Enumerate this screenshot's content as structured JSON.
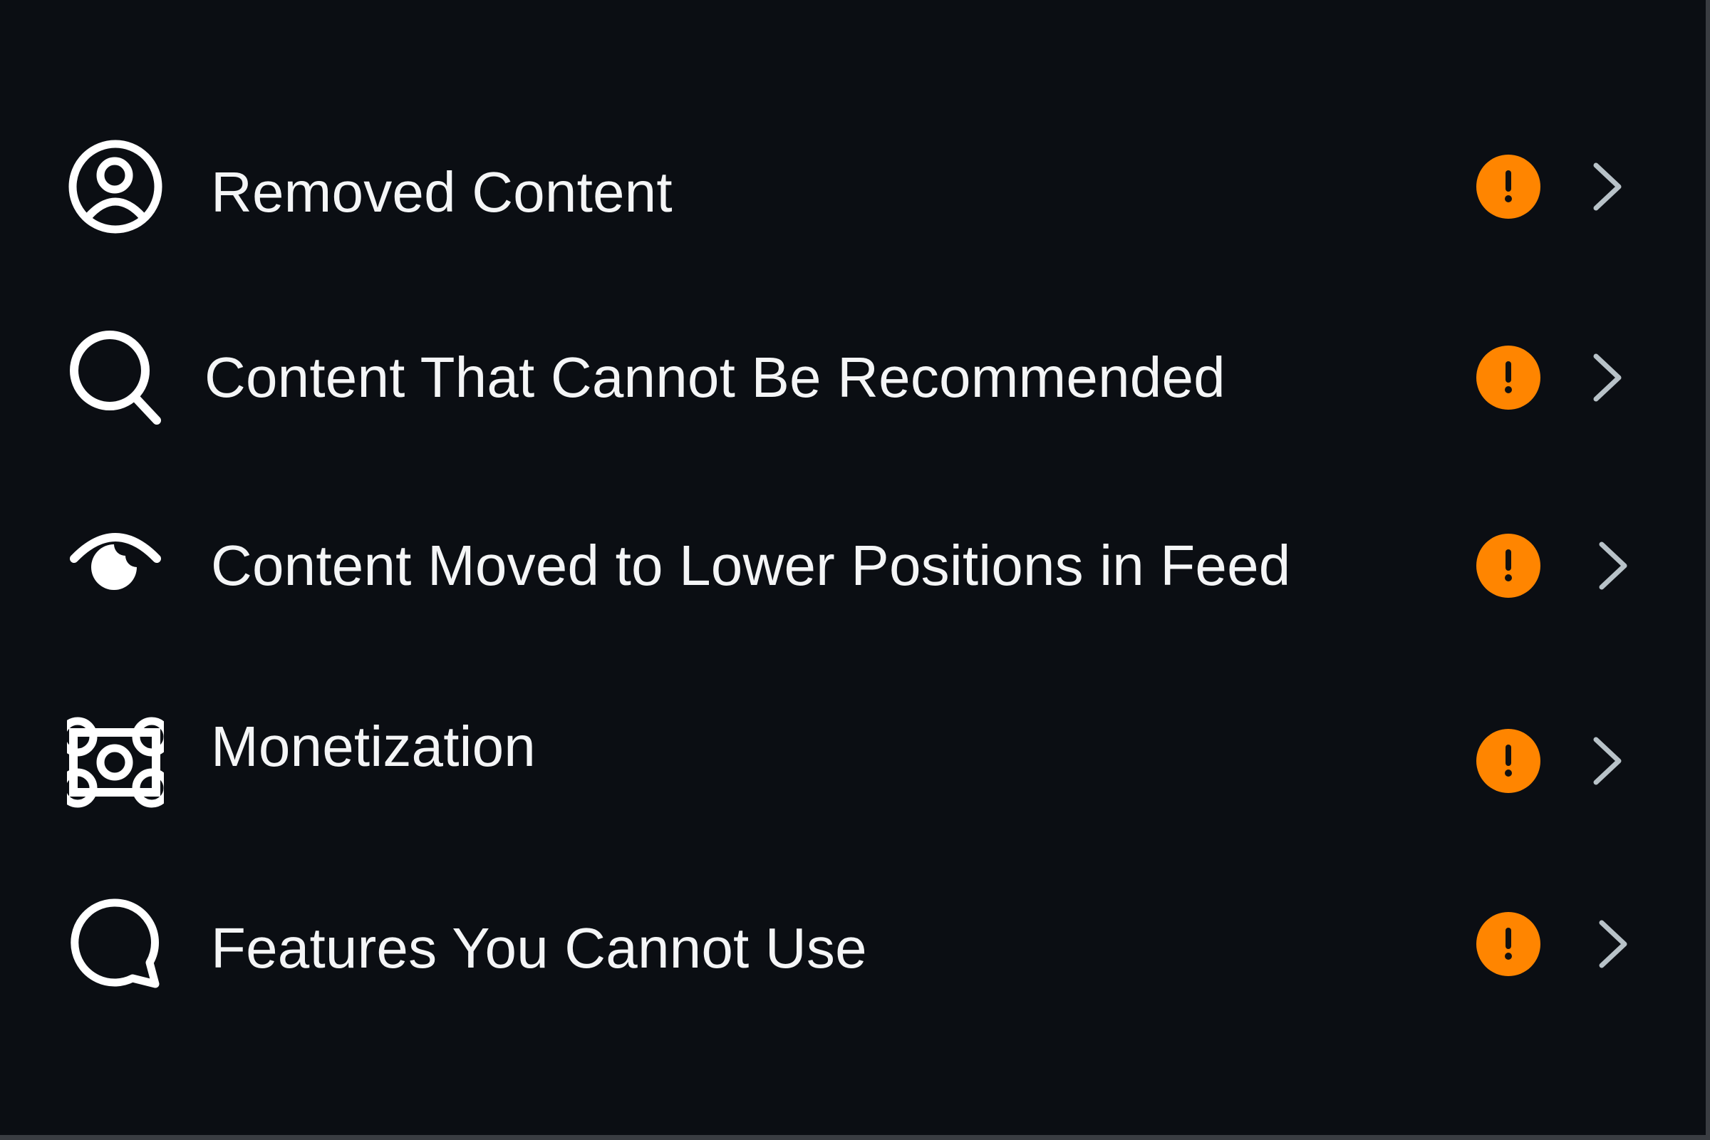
{
  "colors": {
    "background": "#0b0e13",
    "text": "#f4f5f6",
    "warning": "#ff8500",
    "chevron": "#b8c2c8"
  },
  "items": [
    {
      "label": "Removed Content",
      "icon": "user-circle-icon",
      "status_icon": "warning-icon",
      "nav_icon": "chevron-right-icon"
    },
    {
      "label": "Content That Cannot Be Recommended",
      "icon": "search-icon",
      "status_icon": "warning-icon",
      "nav_icon": "chevron-right-icon"
    },
    {
      "label": "Content Moved to Lower Positions in Feed",
      "icon": "eye-icon",
      "status_icon": "warning-icon",
      "nav_icon": "chevron-right-icon"
    },
    {
      "label": "Monetization",
      "icon": "money-icon",
      "status_icon": "warning-icon",
      "nav_icon": "chevron-right-icon"
    },
    {
      "label": "Features You Cannot Use",
      "icon": "chat-bubble-icon",
      "status_icon": "warning-icon",
      "nav_icon": "chevron-right-icon"
    }
  ]
}
